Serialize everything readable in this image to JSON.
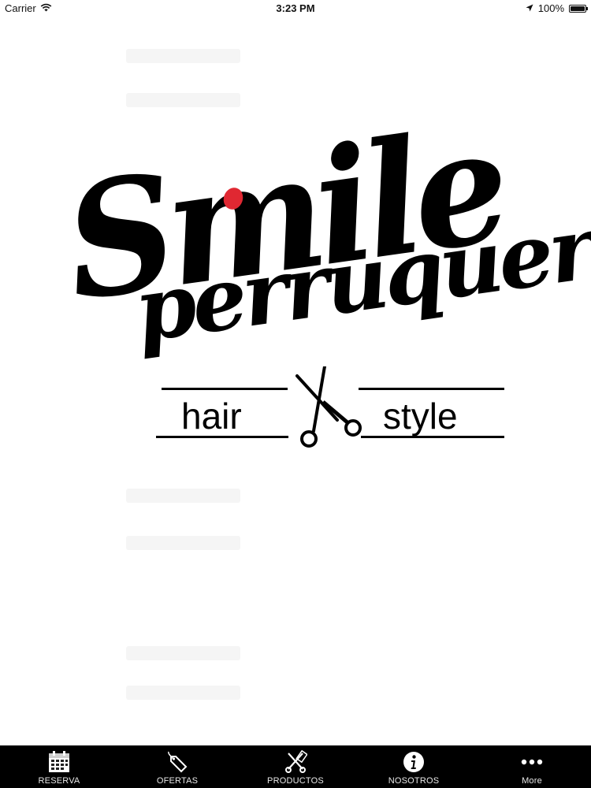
{
  "status_bar": {
    "carrier": "Carrier",
    "time": "3:23 PM",
    "battery": "100%"
  },
  "logo": {
    "brand_line_1": "Smile",
    "brand_line_2": "perruquers",
    "tagline_left": "hair",
    "tagline_right": "style",
    "accent_color": "#e02832"
  },
  "tab_bar": {
    "items": [
      {
        "label": "RESERVA",
        "icon": "calendar-icon"
      },
      {
        "label": "OFERTAS",
        "icon": "tag-icon"
      },
      {
        "label": "PRODUCTOS",
        "icon": "scissors-comb-icon"
      },
      {
        "label": "NOSOTROS",
        "icon": "info-icon"
      },
      {
        "label": "More",
        "icon": "more-dots-icon"
      }
    ]
  }
}
